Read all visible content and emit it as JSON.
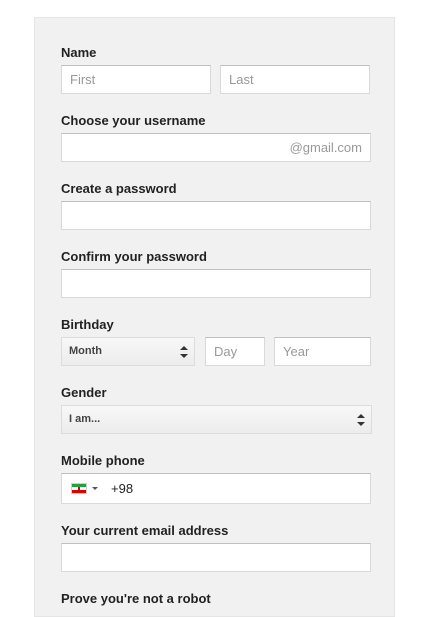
{
  "name": {
    "label": "Name",
    "first_placeholder": "First",
    "last_placeholder": "Last"
  },
  "username": {
    "label": "Choose your username",
    "suffix": "@gmail.com"
  },
  "password": {
    "label": "Create a password"
  },
  "confirm_password": {
    "label": "Confirm your password"
  },
  "birthday": {
    "label": "Birthday",
    "month_selected": "Month",
    "day_placeholder": "Day",
    "year_placeholder": "Year"
  },
  "gender": {
    "label": "Gender",
    "selected": "I am..."
  },
  "mobile": {
    "label": "Mobile phone",
    "country_flag": "iran-flag-icon",
    "value": "+98"
  },
  "email": {
    "label": "Your current email address"
  },
  "robot": {
    "label": "Prove you're not a robot"
  },
  "colors": {
    "panel_bg": "#f1f1f1",
    "input_border": "#d9d9d9",
    "label_text": "#222222",
    "placeholder_text": "#999999"
  }
}
